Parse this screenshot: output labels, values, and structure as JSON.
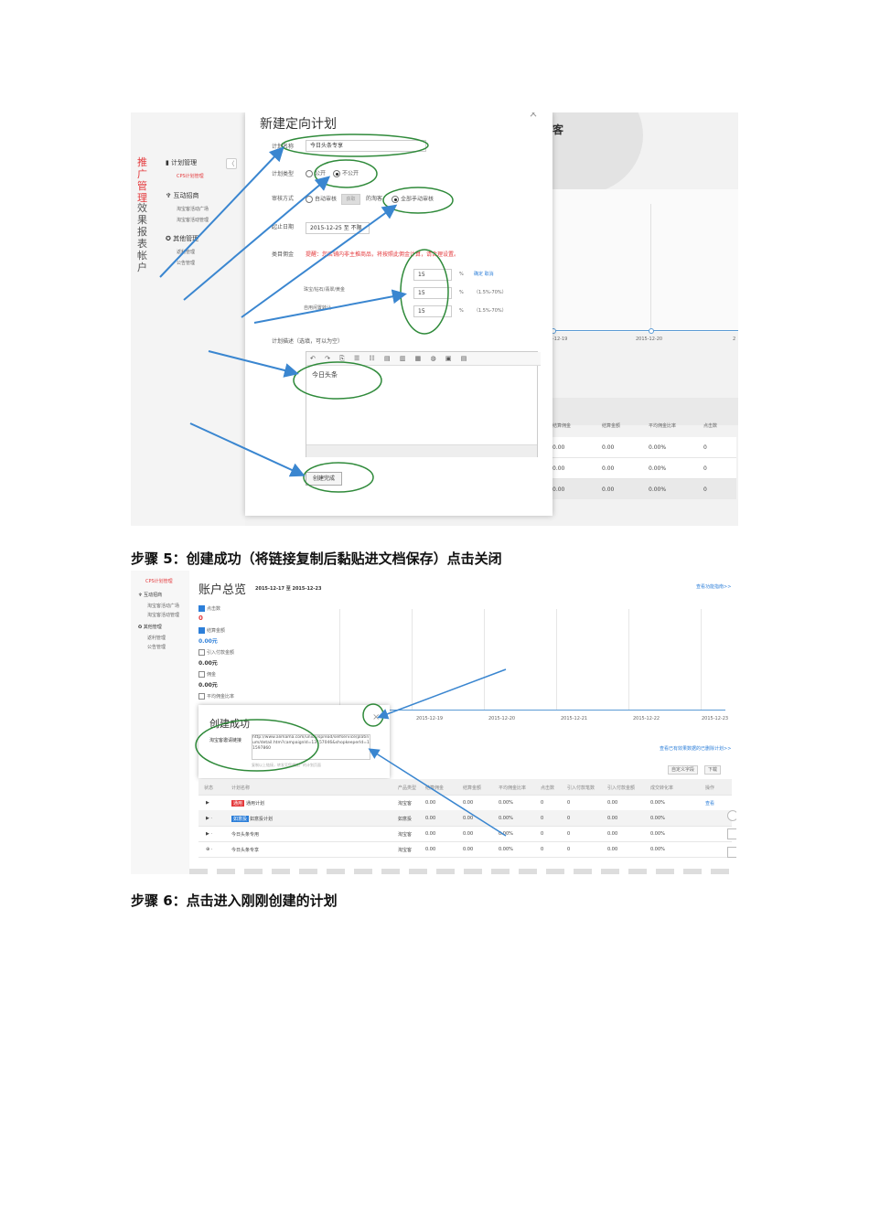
{
  "shot1": {
    "sidebar": {
      "vertical_tabs": [
        "推广管理",
        "效果报表",
        "帐户"
      ],
      "sections": [
        {
          "title": "计划管理",
          "items": [
            "CPS计划管理"
          ]
        },
        {
          "title": "互动招商",
          "items": [
            "淘宝客活动广场",
            "淘宝客活动管理"
          ]
        },
        {
          "title": "其他管理",
          "items": [
            "返利管理",
            "公告管理"
          ]
        }
      ],
      "collapse_glyph": "〈"
    },
    "modal": {
      "title": "新建定向计划",
      "close": "×",
      "plan_name_label": "计划名称",
      "plan_name_value": "今日头条专享",
      "plan_type_label": "计划类型",
      "plan_type_options": [
        "公开",
        "不公开"
      ],
      "review_label": "审核方式",
      "review_auto": "自动审核",
      "review_auto_btn": "获取",
      "review_mid": "的淘客",
      "review_manual": "全部手动审核",
      "end_date_label": "起止日期",
      "end_date_value": "2015-12-25 至 不限",
      "commission_label": "类目佣金",
      "commission_warning": "提醒：您店铺内非主推商品，将按照此佣金计算，请合理设置。",
      "rates": [
        {
          "label": "",
          "value": "15",
          "unit": "%",
          "hint": "确定  取消"
        },
        {
          "label": "珠宝/钻石/翡翠/黄金",
          "value": "15",
          "unit": "%",
          "hint": "（1.5%-70%）"
        },
        {
          "label": "自用闲置转让",
          "value": "15",
          "unit": "%",
          "hint": "（1.5%-70%）"
        }
      ],
      "desc_label": "计划描述（选填，可以为空）",
      "desc_value": "今日头条",
      "submit": "创建完成"
    },
    "bg": {
      "title_fragment": "客",
      "dates": [
        "-12-19",
        "2015-12-20",
        "2"
      ],
      "columns": [
        "结算佣金",
        "结算金额",
        "平均佣金比率",
        "点击数"
      ],
      "rows": [
        [
          "0.00",
          "0.00",
          "0.00%",
          "0"
        ],
        [
          "0.00",
          "0.00",
          "0.00%",
          "0"
        ],
        [
          "0.00",
          "0.00",
          "0.00%",
          "0"
        ]
      ]
    }
  },
  "step5": "步骤 5：创建成功（将链接复制后黏贴进文档保存）点击关闭",
  "shot2": {
    "sidebar": [
      "CPS计划管理",
      "互动招商",
      "淘宝客活动广场",
      "淘宝客活动管理",
      "其他管理",
      "返利管理",
      "公告管理"
    ],
    "header": {
      "title": "账户总览",
      "date_range": "2015-12-17 至 2015-12-23",
      "top_link": "查看功能指南>>"
    },
    "metrics": [
      {
        "label": "点击数",
        "value": "0",
        "checked": true
      },
      {
        "label": "结算金额",
        "value": "0.00元",
        "checked": true
      },
      {
        "label": "引入付款金额",
        "value": "0.00元",
        "checked": false
      },
      {
        "label": "佣金",
        "value": "0.00元",
        "checked": false
      },
      {
        "label": "平均佣金比率",
        "value": "",
        "checked": false
      }
    ],
    "dates": [
      "2015-12-19",
      "2015-12-20",
      "2015-12-21",
      "2015-12-22",
      "2015-12-23"
    ],
    "dialog": {
      "title": "创建成功",
      "close": "×",
      "link_label": "淘宝客邀请链接",
      "link_value": "http://www.alimama.com/union/spread/selfservice/platinum/detail.htm?campaignId=13157046&shopkeeperId=11597860",
      "footer": "复制以上链接，转发至您想推广的计划页面"
    },
    "table_link": "查看已有效果数据的已删除计划>>",
    "buttons": [
      "自定义字段",
      "下载"
    ],
    "columns": [
      "状态",
      "计划名称",
      "产品类型",
      "结算佣金",
      "结算金额",
      "平均佣金比率",
      "点击数",
      "引入付款笔数",
      "引入付款金额",
      "成交转化率",
      "操作"
    ],
    "rows": [
      {
        "name": "通用计划",
        "tag": "通用",
        "type": "淘宝客",
        "vals": [
          "0.00",
          "0.00",
          "0.00%",
          "0",
          "0",
          "0.00",
          "0.00%"
        ],
        "op": "查看"
      },
      {
        "name": "如意投计划",
        "tag": "如意投",
        "type": "如意投",
        "vals": [
          "0.00",
          "0.00",
          "0.00%",
          "0",
          "0",
          "0.00",
          "0.00%"
        ],
        "op": ""
      },
      {
        "name": "今日头条专用",
        "tag": "",
        "type": "淘宝客",
        "vals": [
          "0.00",
          "0.00",
          "0.00%",
          "0",
          "0",
          "0.00",
          "0.00%"
        ],
        "op": ""
      },
      {
        "name": "今日头条专享",
        "tag": "",
        "type": "淘宝客",
        "vals": [
          "0.00",
          "0.00",
          "0.00%",
          "0",
          "0",
          "0.00",
          "0.00%"
        ],
        "op": ""
      }
    ]
  },
  "step6": "步骤 6：点击进入刚刚创建的计划",
  "colors": {
    "arrow": "#3a86d0",
    "ellipse": "#2f8a3a",
    "accent_red": "#e4393c",
    "link_blue": "#2d7fd9"
  }
}
